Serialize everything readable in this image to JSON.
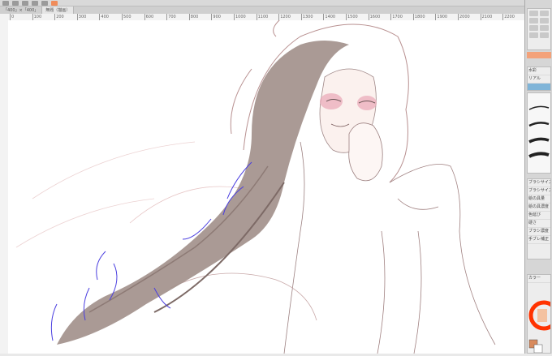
{
  "app": {
    "tabs": [
      "「400」×「400」",
      "無題（描画）"
    ]
  },
  "ruler": {
    "ticks": [
      "0",
      "100",
      "200",
      "300",
      "400",
      "500",
      "600",
      "700",
      "800",
      "900",
      "1000",
      "1100",
      "1200",
      "1300",
      "1400",
      "1500",
      "1600",
      "1700",
      "1800",
      "1900",
      "2000",
      "2100",
      "2200"
    ]
  },
  "panel": {
    "brush_items": [
      "水彩",
      "リアル"
    ],
    "property_title": "ブラシサイズ",
    "property_labels": [
      "ブラシサイズ",
      "絵の具量",
      "絵の具濃度",
      "色延び",
      "硬さ",
      "ブラシ濃度",
      "手ブレ補正"
    ],
    "color_title": "カラー"
  },
  "colors": {
    "accent": "#f08c5a",
    "main_color": "#d88a5c",
    "sub_color": "#ffffff"
  }
}
